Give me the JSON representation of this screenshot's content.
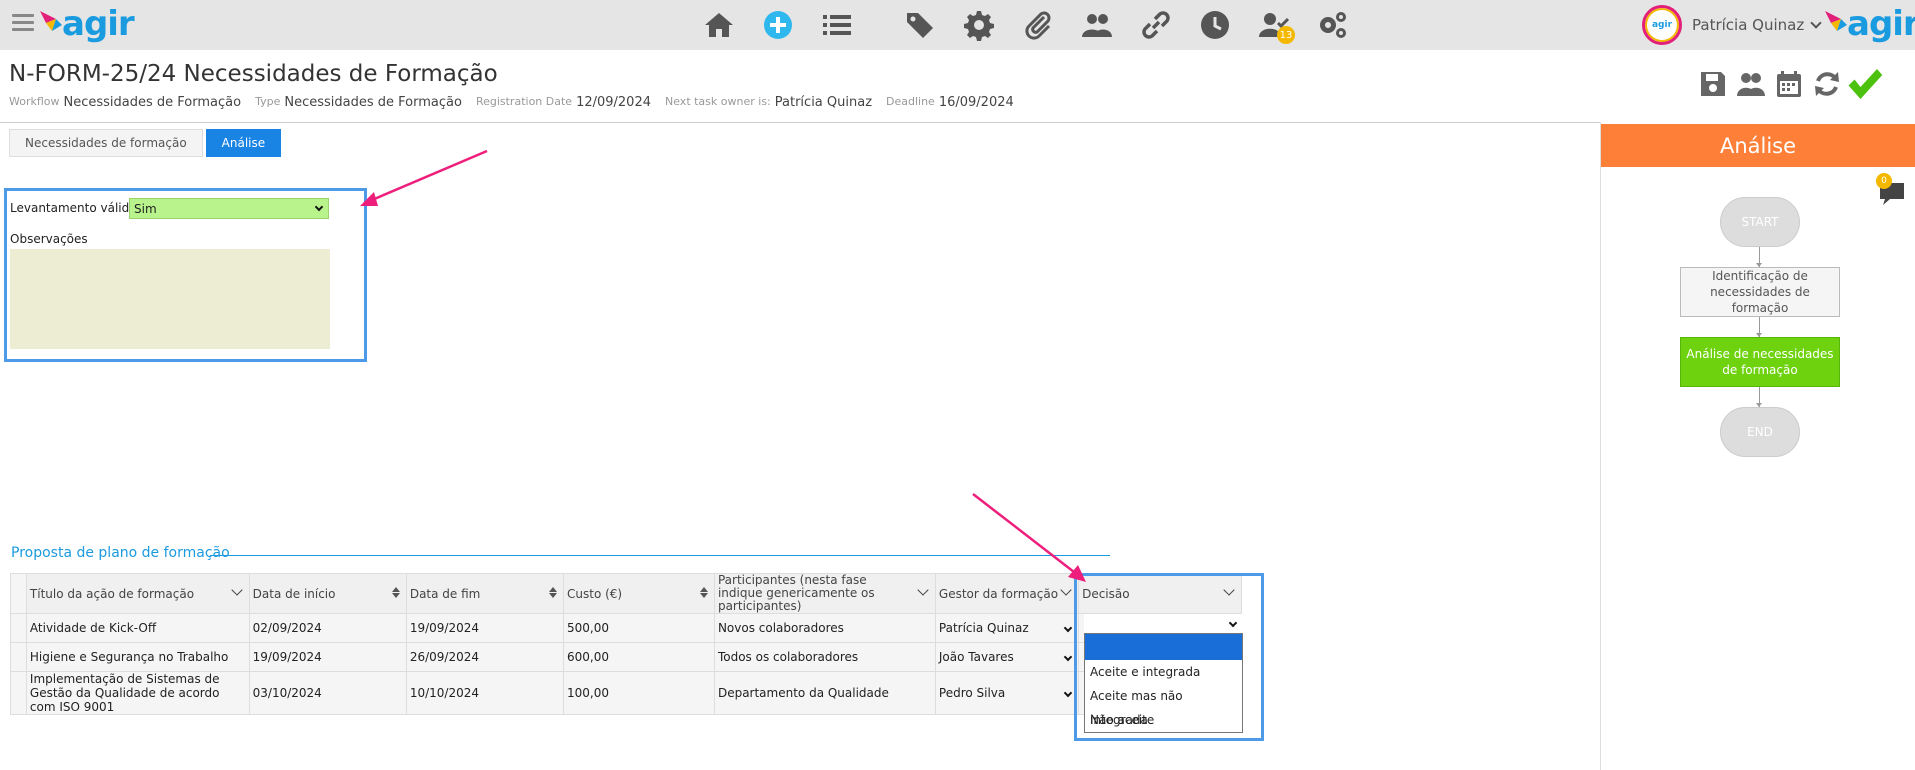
{
  "app": {
    "logo_text": "agir",
    "logo_small_text": "agir"
  },
  "user": {
    "name": "Patrícia Quinaz"
  },
  "nav": {
    "tasks_badge": "13"
  },
  "header": {
    "title": "N-FORM-25/24 Necessidades de Formação",
    "workflow_label": "Workflow",
    "workflow_value": "Necessidades de Formação",
    "type_label": "Type",
    "type_value": "Necessidades de Formação",
    "regdate_label": "Registration Date",
    "regdate_value": "12/09/2024",
    "owner_label": "Next task owner is:",
    "owner_value": "Patrícia Quinaz",
    "deadline_label": "Deadline",
    "deadline_value": "16/09/2024"
  },
  "tabs": [
    {
      "label": "Necessidades de formação",
      "active": false
    },
    {
      "label": "Análise",
      "active": true
    }
  ],
  "form": {
    "levantamento_label": "Levantamento válido?",
    "levantamento_value": "Sim",
    "observacoes_label": "Observações",
    "observacoes_value": ""
  },
  "section": {
    "title": "Proposta de plano de formação"
  },
  "table": {
    "columns": [
      "Título da ação de formação",
      "Data de início",
      "Data de fim",
      "Custo (€)",
      "Participantes (nesta fase indique genericamente os participantes)",
      "Gestor da formação",
      "Decisão"
    ],
    "rows": [
      {
        "titulo": "Atividade de Kick-Off",
        "inicio": "02/09/2024",
        "fim": "19/09/2024",
        "custo": "500,00",
        "participantes": "Novos colaboradores",
        "gestor": "Patrícia Quinaz",
        "decisao": ""
      },
      {
        "titulo": "Higiene e Segurança no Trabalho",
        "inicio": "19/09/2024",
        "fim": "26/09/2024",
        "custo": "600,00",
        "participantes": "Todos os colaboradores",
        "gestor": "João Tavares",
        "decisao": ""
      },
      {
        "titulo": "Implementação de Sistemas de Gestão da Qualidade de acordo com ISO 9001",
        "inicio": "03/10/2024",
        "fim": "10/10/2024",
        "custo": "100,00",
        "participantes": "Departamento da Qualidade",
        "gestor": "Pedro Silva",
        "decisao": ""
      }
    ],
    "decision_options": [
      "",
      "Aceite e integrada",
      "Aceite mas não integrada",
      "Não aceite"
    ]
  },
  "panel": {
    "title": "Análise",
    "comments_badge": "0",
    "workflow": {
      "start": "START",
      "step1": "Identificação de necessidades de formação",
      "step2": "Análise de necessidades de formação",
      "end": "END"
    }
  },
  "colors": {
    "accent": "#1a84e4",
    "panel_header": "#fe8038",
    "active_step": "#6fd20f",
    "highlight_box": "#4d9be8",
    "arrow": "#ee1f7c"
  }
}
